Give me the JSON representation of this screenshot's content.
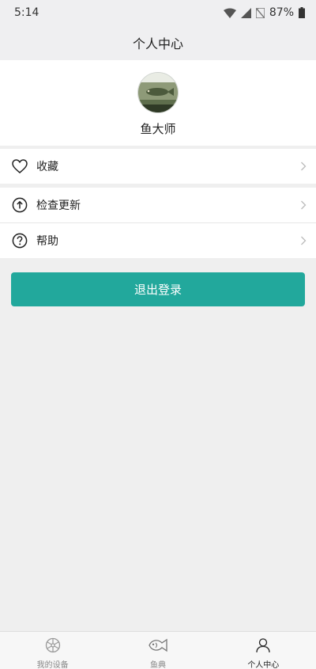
{
  "status_bar": {
    "time": "5:14",
    "battery": "87%"
  },
  "header": {
    "title": "个人中心"
  },
  "profile": {
    "name": "鱼大师"
  },
  "menu": {
    "favorites": {
      "label": "收藏",
      "icon": "heart-icon"
    },
    "check_update": {
      "label": "检查更新",
      "icon": "upload-arrow-icon"
    },
    "help": {
      "label": "帮助",
      "icon": "question-icon"
    }
  },
  "logout": {
    "label": "退出登录"
  },
  "colors": {
    "accent": "#22a89c",
    "background": "#efefef",
    "header": "#efeff1"
  },
  "tabbar": {
    "items": [
      {
        "label": "我的设备",
        "icon": "device-icon",
        "active": false
      },
      {
        "label": "鱼典",
        "icon": "fish-icon",
        "active": false
      },
      {
        "label": "个人中心",
        "icon": "person-icon",
        "active": true
      }
    ]
  }
}
